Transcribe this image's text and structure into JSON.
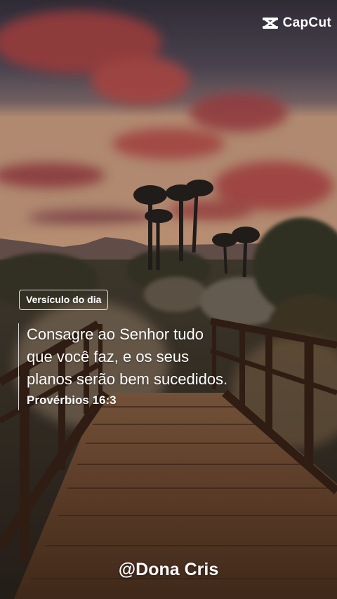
{
  "watermark": {
    "brand": "CapCut",
    "icon": "capcut-logo-icon"
  },
  "badge": {
    "label": "Versículo do dia"
  },
  "verse": {
    "text": "Consagre ao Senhor tudo\nque você faz, e os seus\nplanos serão bem sucedidos.",
    "reference": "Provérbios 16:3"
  },
  "author": {
    "handle": "@Dona Cris"
  },
  "colors": {
    "sky_top": "#3e3a48",
    "cloud": "#c9524f",
    "horizon": "#e3b38a",
    "wood": "#7a4f34",
    "text": "#ffffff"
  }
}
